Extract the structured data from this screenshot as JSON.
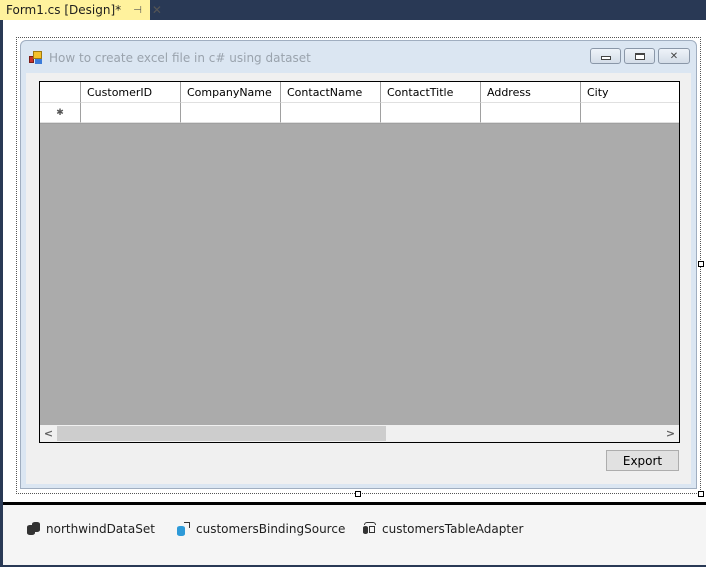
{
  "document_tab": {
    "label": "Form1.cs [Design]*",
    "pin_icon": "⊣",
    "close_icon": "✕"
  },
  "form": {
    "title": "How to create excel file in c# using dataset",
    "buttons": {
      "minimize": "minimize",
      "maximize": "maximize",
      "close": "✕"
    }
  },
  "grid": {
    "columns": [
      "CustomerID",
      "CompanyName",
      "ContactName",
      "ContactTitle",
      "Address",
      "City"
    ],
    "new_row_glyph": "✱",
    "scroll_left": "<",
    "scroll_right": ">"
  },
  "export_button": "Export",
  "component_tray": [
    {
      "name": "northwindDataSet",
      "icon": "dataset-icon"
    },
    {
      "name": "customersBindingSource",
      "icon": "binding-source-icon"
    },
    {
      "name": "customersTableAdapter",
      "icon": "table-adapter-icon"
    }
  ],
  "colors": {
    "tab_active": "#fff29d",
    "ide_frame": "#293955",
    "grid_background": "#ababab",
    "form_border": "#dbe6f2"
  }
}
